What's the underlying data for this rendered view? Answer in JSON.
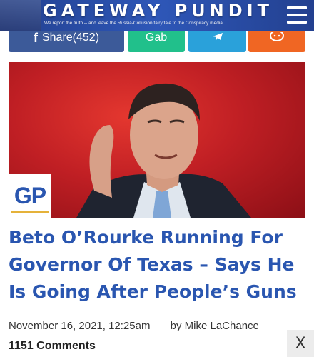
{
  "header": {
    "brand": "GATEWAY PUNDIT",
    "tagline": "We report the truth -- and leave the Russia-Collusion fairy tale to the Conspiracy media",
    "menu_icon": "hamburger-menu-icon",
    "colors": {
      "header_bg": "#2e57b8",
      "brand_text": "#ffffff"
    }
  },
  "share": {
    "facebook_label": "Share(452)",
    "gab_label": "Gab",
    "telegram_icon": "telegram-icon",
    "parler_icon": "parler-icon",
    "colors": {
      "facebook": "#3c5a99",
      "gab": "#21c08b",
      "telegram": "#2aa1da",
      "parler": "#f06623"
    }
  },
  "hero": {
    "badge_text": "GP"
  },
  "article": {
    "title": "Beto O’Rourke Running For Governor Of Texas – Says He Is Going After People’s Guns",
    "date": "November 16, 2021, 12:25am",
    "author": "by Mike LaChance",
    "comments": "1151 Comments",
    "title_color": "#2a56b0"
  },
  "overlay": {
    "close_label": "X"
  }
}
